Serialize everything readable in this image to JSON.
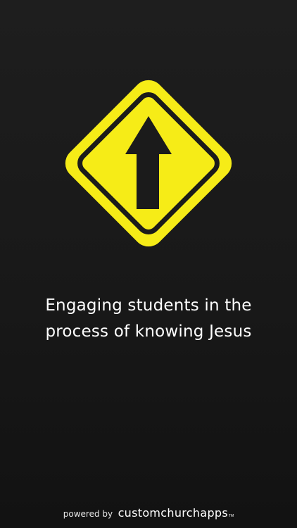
{
  "colors": {
    "background": "#1a1a1a",
    "sign_yellow": "#f6ec17",
    "sign_dark": "#1b1b1b",
    "text": "#ffffff"
  },
  "logo": {
    "icon": "yellow-diamond-road-sign-with-up-arrow"
  },
  "tagline": {
    "line1": "Engaging students in the",
    "line2": "process of knowing Jesus"
  },
  "footer": {
    "powered_by": "powered by",
    "brand": "customchurchapps",
    "trademark": "TM"
  }
}
